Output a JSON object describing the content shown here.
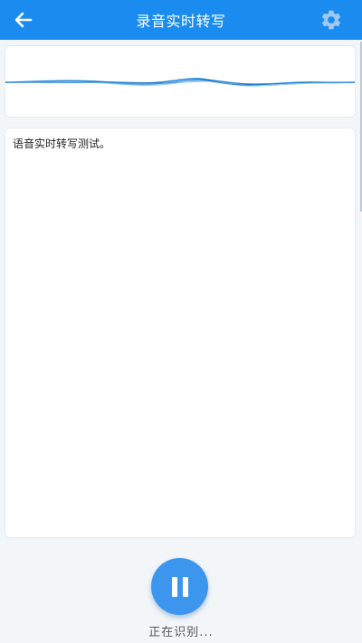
{
  "header": {
    "title": "录音实时转写",
    "back_icon": "arrow-left-icon",
    "settings_icon": "gear-icon",
    "bg_color": "#1a8cf0"
  },
  "waveform": {
    "color": "#1a7fd4"
  },
  "transcript": {
    "text": "语音实时转写测试。"
  },
  "controls": {
    "pause_icon": "pause-icon",
    "button_color": "#3d96ee",
    "status_text": "正在识别..."
  }
}
